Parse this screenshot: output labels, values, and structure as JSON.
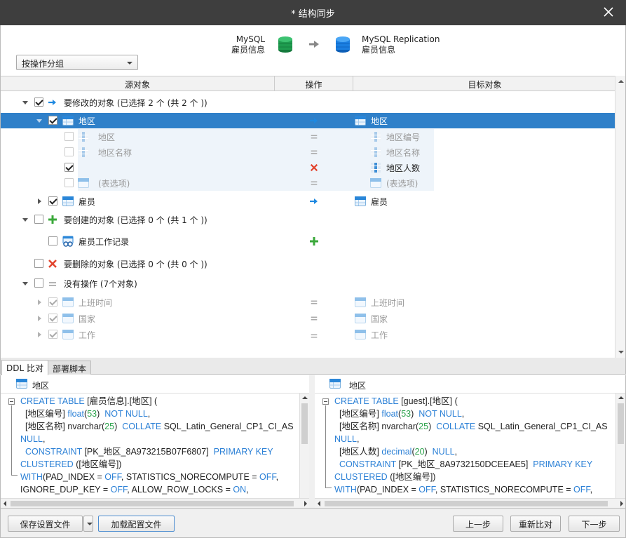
{
  "window": {
    "title": "* 结构同步"
  },
  "source": {
    "type": "MySQL",
    "schema": "雇员信息"
  },
  "target": {
    "type": "MySQL Replication",
    "schema": "雇员信息"
  },
  "group_select": {
    "value": "按操作分组"
  },
  "columns": {
    "source": "源对象",
    "operation": "操作",
    "target": "目标对象"
  },
  "tree": {
    "modify_group": "要修改的对象 (已选择 2 个 (共 2 个 ))",
    "diqu": "地区",
    "diqu_fields": [
      "地区",
      "地区名称"
    ],
    "target_fields": [
      "地区编号",
      "地区名称",
      "地区人数"
    ],
    "table_options": "(表选项)",
    "guyuan": "雇员",
    "create_group": "要创建的对象 (已选择 0 个 (共 1 个 ))",
    "create_item": "雇员工作记录",
    "delete_group": "要删除的对象 (已选择 0 个 (共 0 个 ))",
    "noop_group": "没有操作 (7个对象)",
    "noop_items": [
      "上班时间",
      "国家",
      "工作"
    ]
  },
  "tabs": [
    "DDL 比对",
    "部署脚本"
  ],
  "ddl_left": {
    "title": "地区",
    "lines": [
      [
        [
          "kw",
          "CREATE TABLE"
        ],
        [
          "t",
          " [雇员信息].[地区] ("
        ]
      ],
      [
        [
          "t",
          "  [地区编号] "
        ],
        [
          "kw",
          "float"
        ],
        [
          "t",
          "("
        ],
        [
          "num",
          "53"
        ],
        [
          "t",
          ")  "
        ],
        [
          "kw",
          "NOT NULL"
        ],
        [
          "t",
          ","
        ]
      ],
      [
        [
          "t",
          "  [地区名称] nvarchar("
        ],
        [
          "num",
          "25"
        ],
        [
          "t",
          ")  "
        ],
        [
          "kw",
          "COLLATE"
        ],
        [
          "t",
          " SQL_Latin_General_CP1_CI_AS"
        ]
      ],
      [
        [
          "kw",
          "NULL"
        ],
        [
          "t",
          ","
        ]
      ],
      [
        [
          "t",
          "  "
        ],
        [
          "kw",
          "CONSTRAINT"
        ],
        [
          "t",
          " [PK_地区_8A973215B07F6807]  "
        ],
        [
          "kw",
          "PRIMARY KEY"
        ]
      ],
      [
        [
          "kw",
          "CLUSTERED"
        ],
        [
          "t",
          " ([地区编号])"
        ]
      ],
      [
        [
          "kw",
          "WITH"
        ],
        [
          "t",
          "(PAD_INDEX = "
        ],
        [
          "kw",
          "OFF"
        ],
        [
          "t",
          ", STATISTICS_NORECOMPUTE = "
        ],
        [
          "kw",
          "OFF"
        ],
        [
          "t",
          ","
        ]
      ],
      [
        [
          "t",
          "IGNORE_DUP_KEY = "
        ],
        [
          "kw",
          "OFF"
        ],
        [
          "t",
          ", ALLOW_ROW_LOCKS = "
        ],
        [
          "kw",
          "ON"
        ],
        [
          "t",
          ","
        ]
      ]
    ]
  },
  "ddl_right": {
    "title": "地区",
    "lines": [
      [
        [
          "kw",
          "CREATE TABLE"
        ],
        [
          "t",
          " [guest].[地区] ("
        ]
      ],
      [
        [
          "t",
          "  [地区编号] "
        ],
        [
          "kw",
          "float"
        ],
        [
          "t",
          "("
        ],
        [
          "num",
          "53"
        ],
        [
          "t",
          ")  "
        ],
        [
          "kw",
          "NOT NULL"
        ],
        [
          "t",
          ","
        ]
      ],
      [
        [
          "t",
          "  [地区名称] nvarchar("
        ],
        [
          "num",
          "25"
        ],
        [
          "t",
          ")  "
        ],
        [
          "kw",
          "COLLATE"
        ],
        [
          "t",
          " SQL_Latin_General_CP1_CI_AS"
        ]
      ],
      [
        [
          "kw",
          "NULL"
        ],
        [
          "t",
          ","
        ]
      ],
      [
        [
          "t",
          "  [地区人数] "
        ],
        [
          "kw",
          "decimal"
        ],
        [
          "t",
          "("
        ],
        [
          "num",
          "20"
        ],
        [
          "t",
          ")  "
        ],
        [
          "kw",
          "NULL"
        ],
        [
          "t",
          ","
        ]
      ],
      [
        [
          "t",
          "  "
        ],
        [
          "kw",
          "CONSTRAINT"
        ],
        [
          "t",
          " [PK_地区_8A9732150DCEEAE5]  "
        ],
        [
          "kw",
          "PRIMARY KEY"
        ]
      ],
      [
        [
          "kw",
          "CLUSTERED"
        ],
        [
          "t",
          " ([地区编号])"
        ]
      ],
      [
        [
          "kw",
          "WITH"
        ],
        [
          "t",
          "(PAD_INDEX = "
        ],
        [
          "kw",
          "OFF"
        ],
        [
          "t",
          ", STATISTICS_NORECOMPUTE = "
        ],
        [
          "kw",
          "OFF"
        ],
        [
          "t",
          ","
        ]
      ]
    ]
  },
  "footer": {
    "save_config": "保存设置文件",
    "load_config": "加载配置文件",
    "prev": "上一步",
    "recompare": "重新比对",
    "next": "下一步"
  },
  "colors": {
    "selected_row": "#2f80c9",
    "keyword": "#2b80d6",
    "number": "#2aa24a",
    "title_bar": "#3e3e3e"
  }
}
